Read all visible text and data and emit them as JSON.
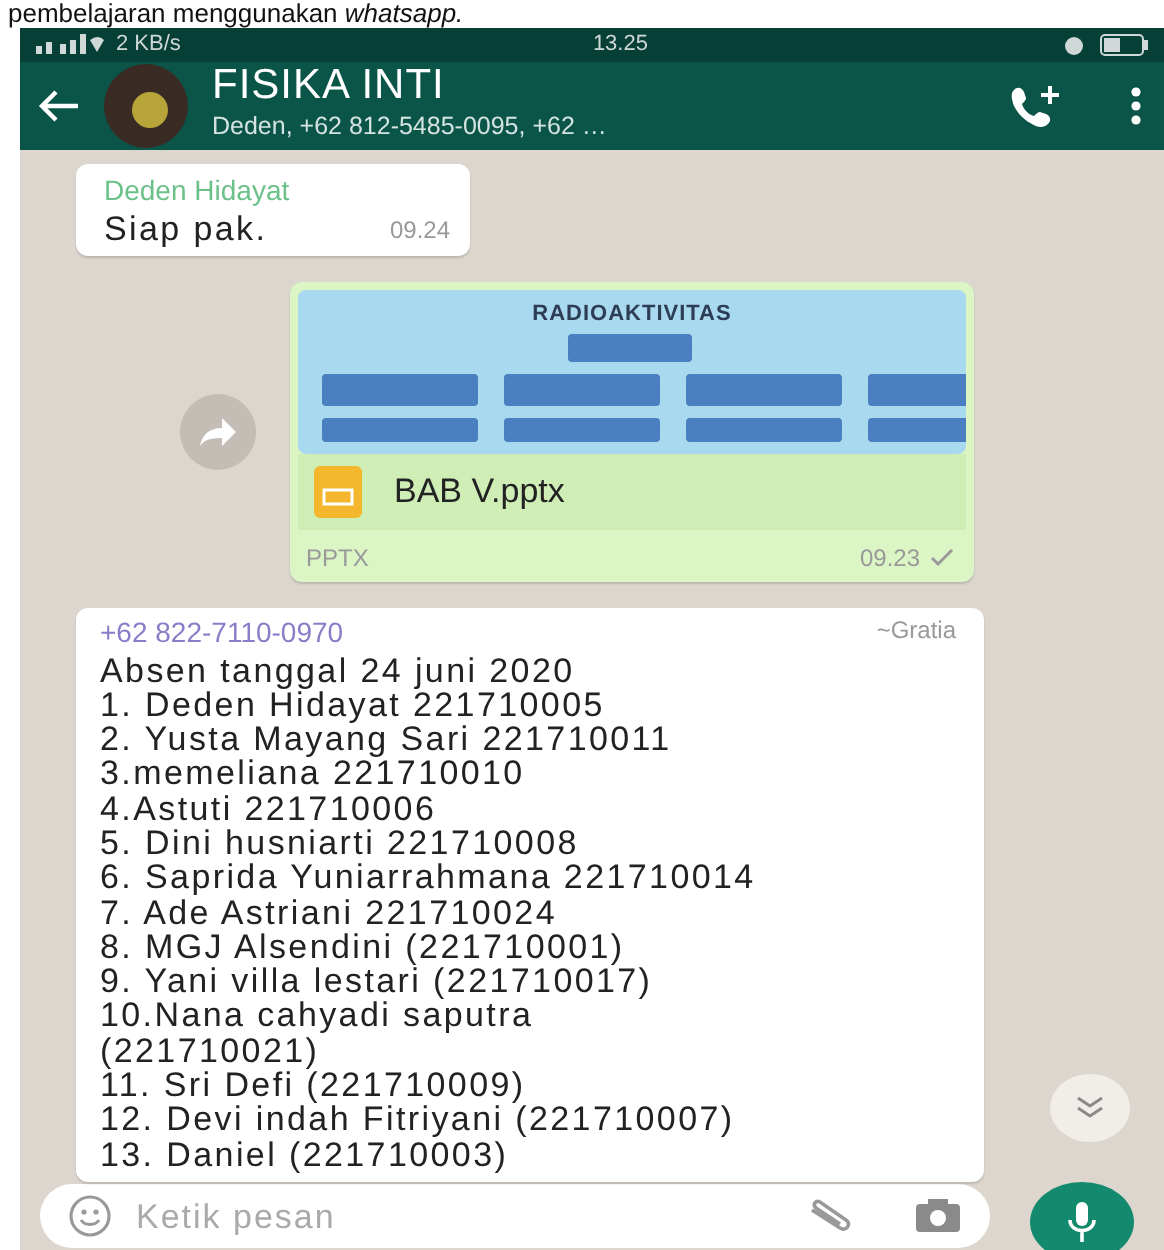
{
  "caption": "pembelajaran menggunakan *whatsapp.*",
  "status_bar": {
    "speed": "2 KB/s",
    "time": "13.25"
  },
  "header": {
    "title": "FISIKA INTI",
    "subtitle": "Deden, +62 812-5485-0095, +62 …"
  },
  "messages": [
    {
      "kind": "text",
      "sender": "Deden Hidayat",
      "text": "Siap pak.",
      "time": "09.24"
    },
    {
      "kind": "document",
      "preview_title": "RADIOAKTIVITAS",
      "file_name": "BAB V.pptx",
      "file_type": "PPTX",
      "time": "09.23",
      "delivered": false
    },
    {
      "kind": "list",
      "sender": "+62 822-7110-0970",
      "sender_name": "~Gratia",
      "lines": [
        "Absen tanggal 24 juni 2020",
        "1. Deden Hidayat 221710005",
        "2. Yusta Mayang Sari 221710011",
        "3.memeliana 221710010",
        "4.Astuti 221710006",
        "5. Dini husniarti 221710008",
        "6. Saprida Yuniarrahmana 221710014",
        "7. Ade Astriani 221710024",
        "8. MGJ Alsendini (221710001)",
        "9. Yani villa lestari (221710017)",
        "10.Nana cahyadi saputra",
        "(221710021)",
        "11. Sri Defi (221710009)",
        "12. Devi indah Fitriyani (221710007)",
        "13. Daniel (221710003)"
      ]
    }
  ],
  "input": {
    "placeholder": "Ketik pesan"
  }
}
